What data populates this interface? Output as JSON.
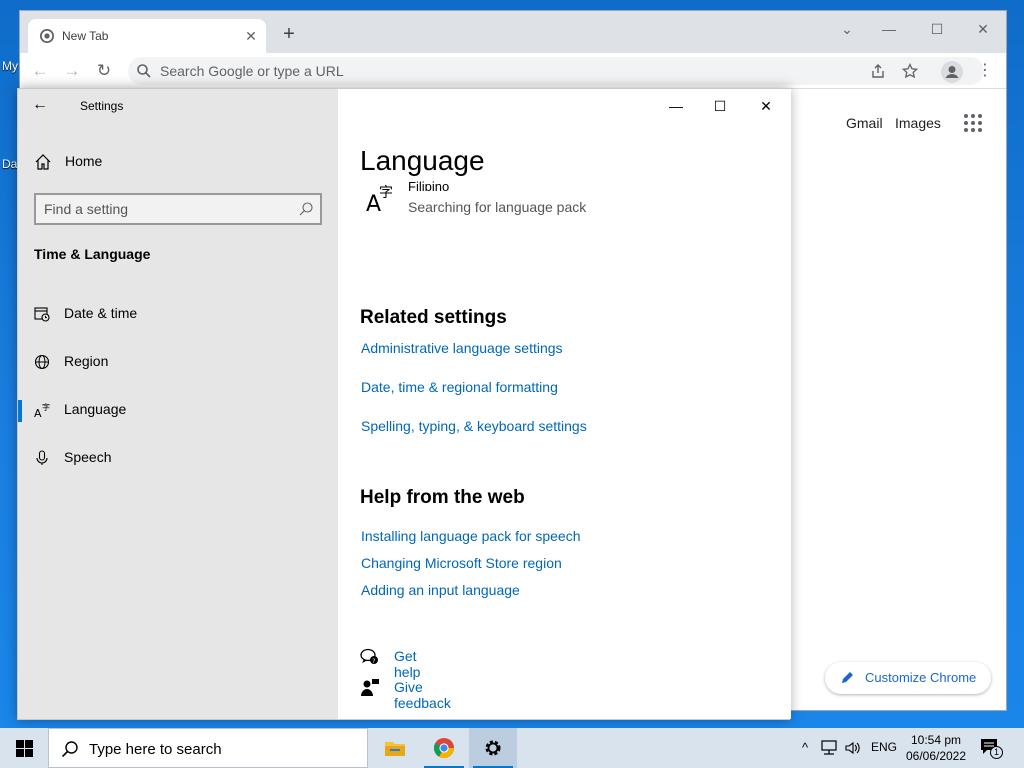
{
  "desktop": {
    "icon_labels": [
      "My",
      "Da"
    ]
  },
  "chrome": {
    "tab_title": "New Tab",
    "tab_close": "✕",
    "new_tab": "+",
    "omnibox_placeholder": "Search Google or type a URL",
    "gmail": "Gmail",
    "images": "Images",
    "customize": "Customize Chrome"
  },
  "settings": {
    "title": "Settings",
    "home": "Home",
    "find_placeholder": "Find a setting",
    "section": "Time & Language",
    "nav": [
      {
        "label": "Date & time"
      },
      {
        "label": "Region"
      },
      {
        "label": "Language"
      },
      {
        "label": "Speech"
      }
    ],
    "page_title": "Language",
    "language_item": {
      "name": "Filipino",
      "status": "Searching for language pack"
    },
    "related_title": "Related settings",
    "related_links": [
      "Administrative language settings",
      "Date, time & regional formatting",
      "Spelling, typing, & keyboard settings"
    ],
    "help_title": "Help from the web",
    "help_links": [
      "Installing language pack for speech",
      "Changing Microsoft Store region",
      "Adding an input language"
    ],
    "get_help": "Get help",
    "give_feedback": "Give feedback"
  },
  "taskbar": {
    "search": "Type here to search",
    "lang": "ENG",
    "time": "10:54 pm",
    "date": "06/06/2022",
    "notification_count": "1"
  },
  "colors": {
    "accent": "#0078d4",
    "link": "#0067b8"
  }
}
